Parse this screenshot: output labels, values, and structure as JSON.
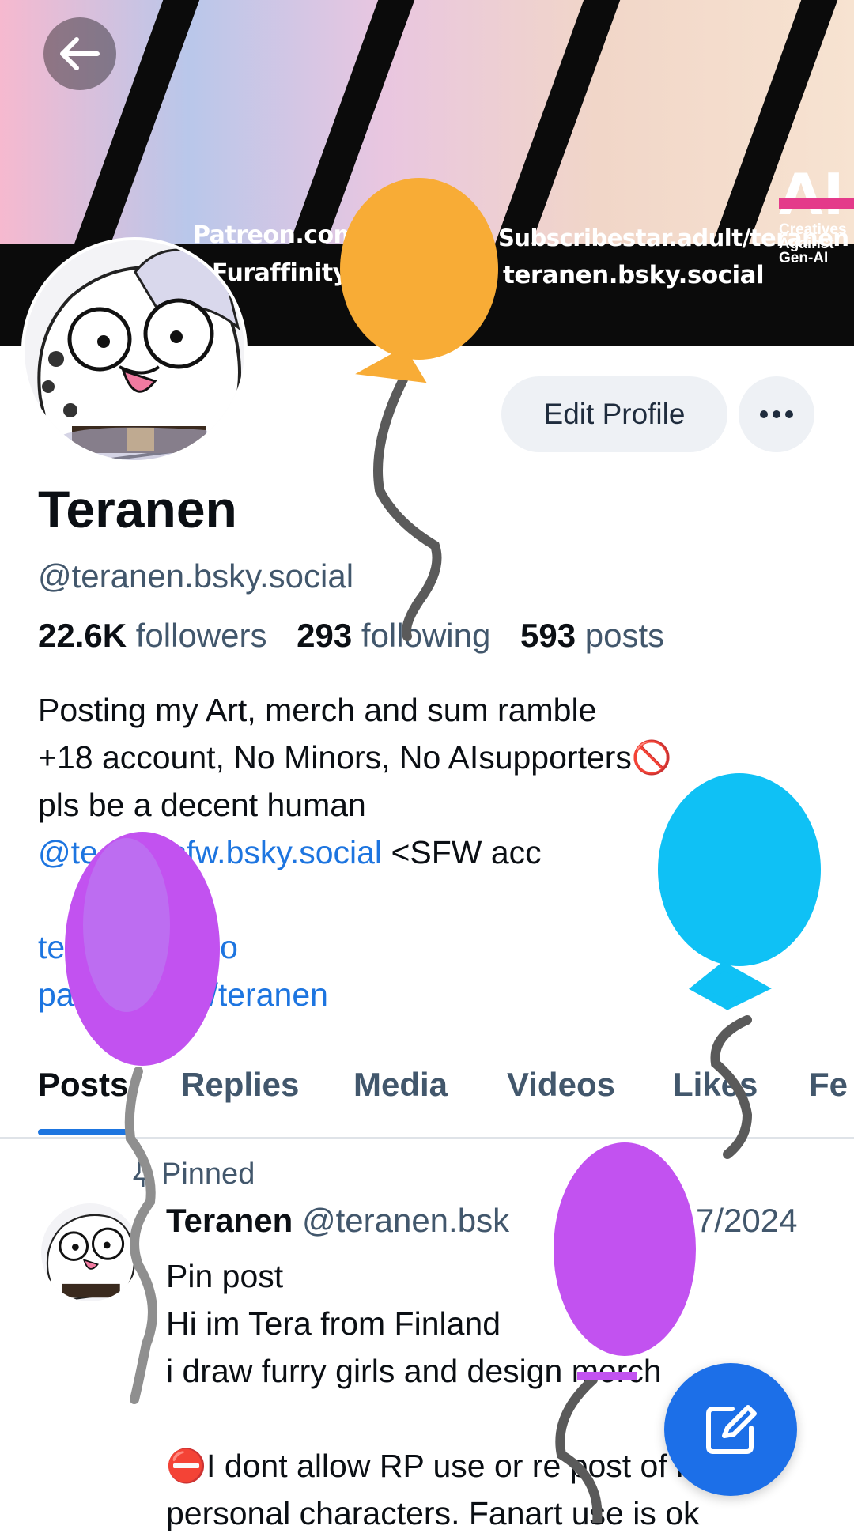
{
  "banner": {
    "text_patreon": "Patreon.com/",
    "text_furaffinity": "Furaffinity.ne",
    "text_subscribestar": "Subscribestar.adult/teranen",
    "text_bsky": "teranen.bsky.social",
    "ai_badge": {
      "big": "AI",
      "line1": "Creatives",
      "line2": "Against",
      "line3": "Gen-AI"
    }
  },
  "profile": {
    "display_name": "Teranen",
    "handle": "@teranen.bsky.social",
    "edit_button": "Edit Profile",
    "stats": {
      "followers_count": "22.6K",
      "followers_label": "followers",
      "following_count": "293",
      "following_label": "following",
      "posts_count": "593",
      "posts_label": "posts"
    },
    "bio": {
      "line1": "Posting my Art, merch and sum ramble",
      "line2": "+18 account, No Minors, No AIsupporters🚫",
      "line3": "pls be a decent human",
      "line4_link": "@te        sfw.bsky.social",
      "line4_text": " <SFW acc",
      "line6_link": "te          rrd.co",
      "line7_link": "pa          om/teranen"
    }
  },
  "tabs": [
    {
      "label": "Posts"
    },
    {
      "label": "Replies"
    },
    {
      "label": "Media"
    },
    {
      "label": "Videos"
    },
    {
      "label": "Likes"
    },
    {
      "label": "Fe"
    }
  ],
  "post": {
    "pinned_label": "Pinned",
    "author": "Teranen",
    "handle": "@teranen.bsk",
    "date": "7/2024",
    "line1": "Pin post",
    "line2": "Hi im Tera from Finland",
    "line3": "i draw furry girls and design merch",
    "line4": "",
    "line5": "⛔I dont allow RP use or re post of my",
    "line6": "personal characters. Fanart use is ok"
  },
  "colors": {
    "accent": "#1d75e0",
    "fab": "#1c6fe8",
    "muted": "#42576c"
  },
  "icons": [
    "back-arrow-icon",
    "more-dots-icon",
    "pin-icon",
    "compose-icon"
  ]
}
